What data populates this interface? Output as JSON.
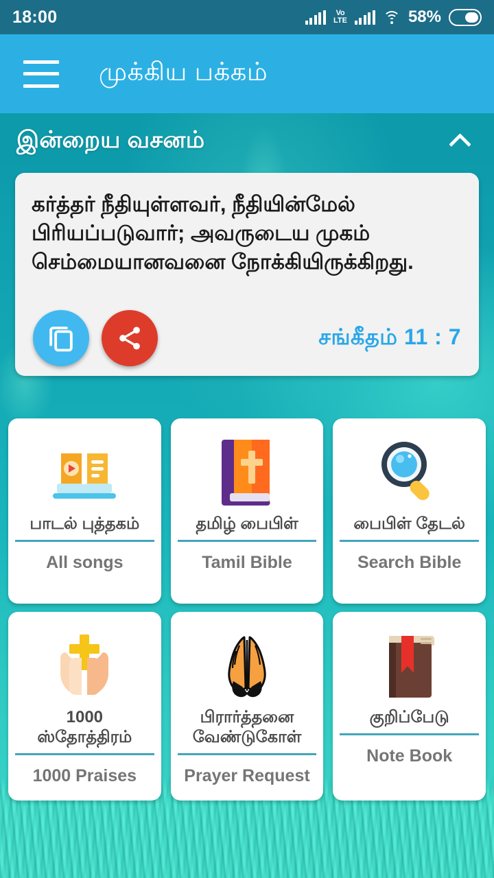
{
  "statusbar": {
    "time": "18:00",
    "network_label_top": "Vo",
    "network_label_bottom": "LTE",
    "battery_percent": "58%"
  },
  "appbar": {
    "menu_icon": "hamburger-menu-icon",
    "title": "முக்கிய பக்கம்"
  },
  "verse_section": {
    "heading": "இன்றைய வசனம்",
    "collapse_icon": "chevron-up-icon",
    "verse_text": "கர்த்தர் நீதியுள்ளவர், நீதியின்மேல் பிரியப்படுவார்; அவருடைய முகம் செம்மையானவனை நோக்கியிருக்கிறது.",
    "copy_icon": "copy-icon",
    "share_icon": "share-icon",
    "reference": "சங்கீதம் 11 : 7",
    "accent_ref_color": "#29a7e8",
    "copy_button_color": "#42b8f0",
    "share_button_color": "#dd3c2b"
  },
  "grid": {
    "tiles": [
      {
        "icon": "songbook-laptop-icon",
        "label_ta": "பாடல் புத்தகம்",
        "label_en": "All songs"
      },
      {
        "icon": "bible-book-cross-icon",
        "label_ta": "தமிழ் பைபிள்",
        "label_en": "Tamil Bible"
      },
      {
        "icon": "magnifier-search-icon",
        "label_ta": "பைபிள் தேடல்",
        "label_en": "Search Bible"
      },
      {
        "icon": "hands-holding-cross-icon",
        "label_ta": "1000\nஸ்தோத்திரம்",
        "label_en": "1000 Praises"
      },
      {
        "icon": "praying-hands-icon",
        "label_ta": "பிரார்த்தனை\nவேண்டுகோள்",
        "label_en": "Prayer Request"
      },
      {
        "icon": "notebook-bookmark-icon",
        "label_ta": "குறிப்பேடு",
        "label_en": "Note Book"
      }
    ],
    "divider_color": "#42a5bb"
  },
  "theme": {
    "statusbar_bg": "#1c6d87",
    "appbar_bg": "#2cb0e4",
    "background_top": "#0e9aa8",
    "background_bottom": "#44dcca",
    "card_bg": "#f2f2f2",
    "tile_bg": "#ffffff"
  }
}
